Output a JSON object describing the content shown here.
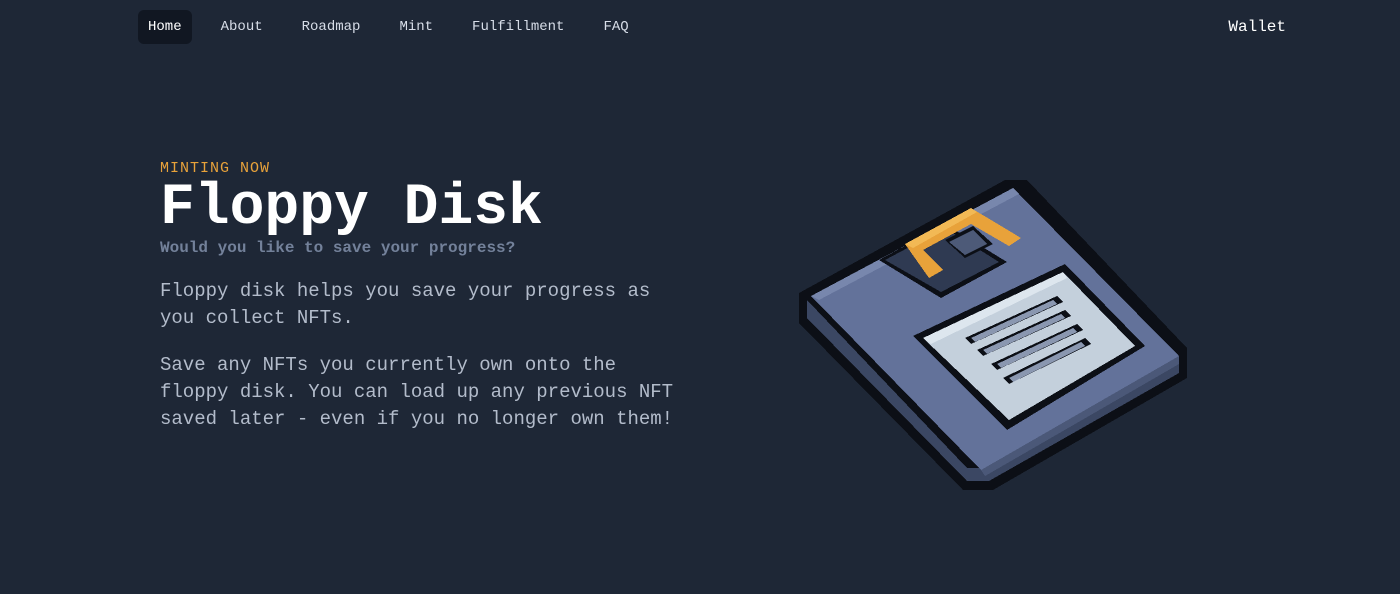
{
  "nav": {
    "links": [
      {
        "label": "Home",
        "active": true
      },
      {
        "label": "About",
        "active": false
      },
      {
        "label": "Roadmap",
        "active": false
      },
      {
        "label": "Mint",
        "active": false
      },
      {
        "label": "Fulfillment",
        "active": false
      },
      {
        "label": "FAQ",
        "active": false
      }
    ],
    "wallet_label": "Wallet"
  },
  "hero": {
    "eyebrow": "MINTING NOW",
    "title": "Floppy Disk",
    "subtitle": "Would you like to save your progress?",
    "paragraph_1": "Floppy disk helps you save your progress as you collect NFTs.",
    "paragraph_2": "Save any NFTs you currently own onto the floppy disk. You can load up any previous NFT saved later - even if you no longer own them!"
  },
  "image": {
    "icon": "floppy-disk-pixel-art-icon"
  },
  "colors": {
    "background": "#1e2736",
    "accent": "#e8a23a",
    "subtitle": "#73819a",
    "body_text": "#b3bccb",
    "disk_body": "#5f6e90",
    "disk_label": "#c4d0dc"
  }
}
